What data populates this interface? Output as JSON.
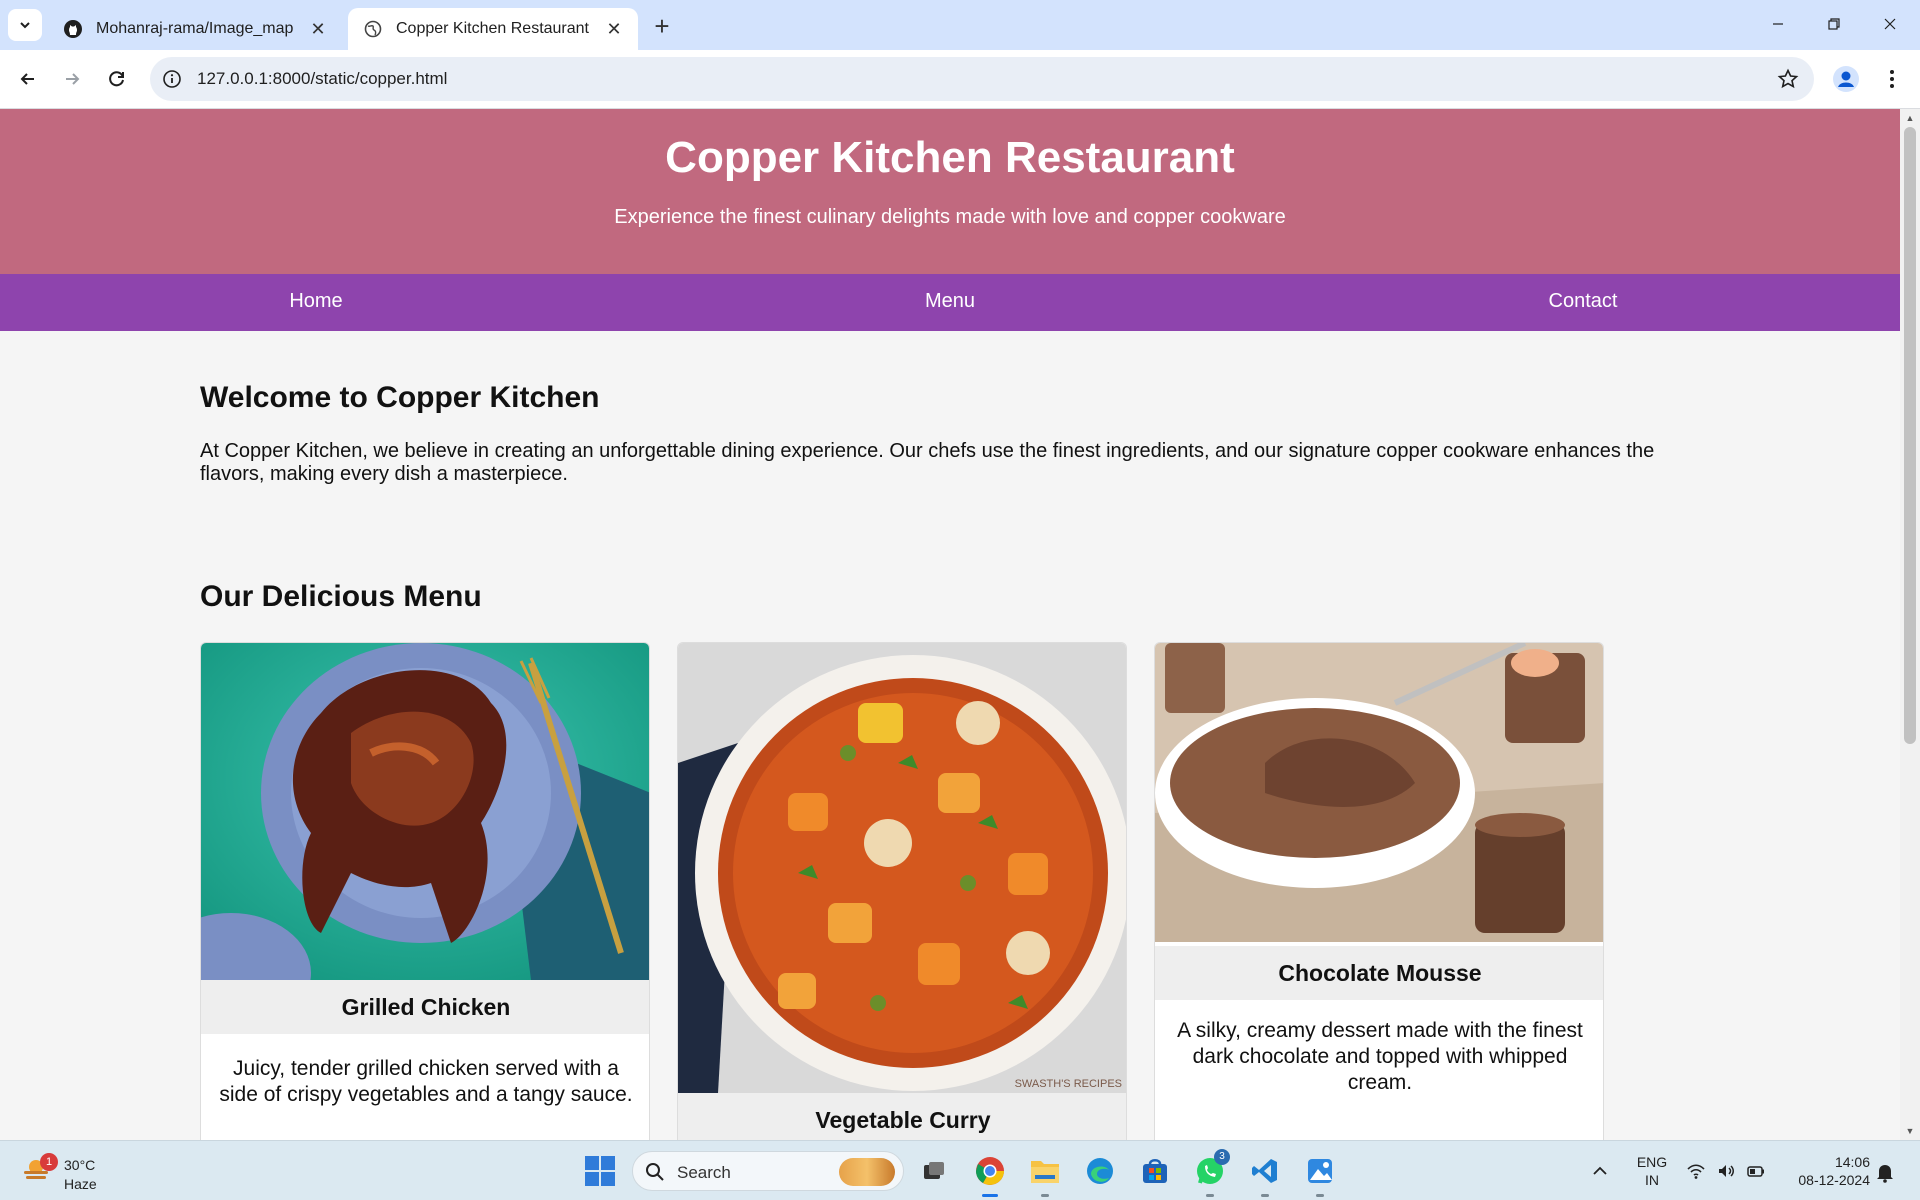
{
  "browser": {
    "tabs": [
      {
        "title": "Mohanraj-rama/Image_map",
        "favicon": "github-icon",
        "active": false
      },
      {
        "title": "Copper Kitchen Restaurant",
        "favicon": "globe-icon",
        "active": true
      }
    ],
    "url": "127.0.0.1:8000/static/copper.html"
  },
  "page": {
    "header": {
      "title": "Copper Kitchen Restaurant",
      "subtitle": "Experience the finest culinary delights made with love and copper cookware"
    },
    "nav": {
      "home": "Home",
      "menu": "Menu",
      "contact": "Contact"
    },
    "welcome": {
      "heading": "Welcome to Copper Kitchen",
      "text": "At Copper Kitchen, we believe in creating an unforgettable dining experience. Our chefs use the finest ingredients, and our signature copper cookware enhances the flavors, making every dish a masterpiece."
    },
    "menu": {
      "heading": "Our Delicious Menu",
      "items": [
        {
          "name": "Grilled Chicken",
          "description": "Juicy, tender grilled chicken served with a side of crispy vegetables and a tangy sauce."
        },
        {
          "name": "Vegetable Curry",
          "description": ""
        },
        {
          "name": "Chocolate Mousse",
          "description": "A silky, creamy dessert made with the finest dark chocolate and topped with whipped cream."
        }
      ],
      "watermark": "SWASTH'S RECIPES"
    },
    "colors": {
      "header": "#c1697f",
      "nav": "#8e44ad",
      "background": "#f5f5f5"
    }
  },
  "taskbar": {
    "weather": {
      "temp": "30°C",
      "condition": "Haze",
      "badge": "1"
    },
    "search_placeholder": "Search",
    "whatsapp_badge": "3",
    "language": {
      "line1": "ENG",
      "line2": "IN"
    },
    "clock": {
      "time": "14:06",
      "date": "08-12-2024"
    }
  }
}
